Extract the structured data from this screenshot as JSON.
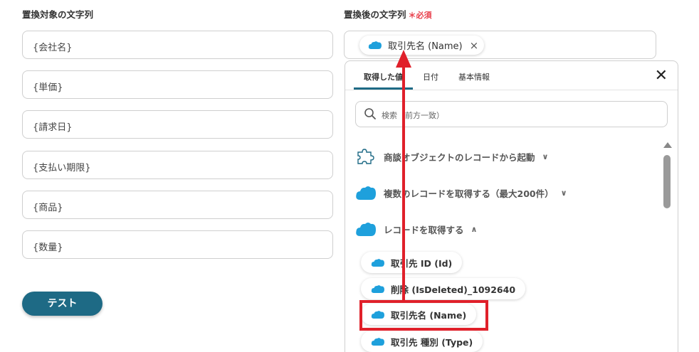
{
  "left": {
    "label": "置換対象の文字列",
    "fields": [
      "{会社名}",
      "{単価}",
      "{請求日}",
      "{支払い期限}",
      "{商品}",
      "{数量}"
    ],
    "test_button": "テスト"
  },
  "right": {
    "label": "置換後の文字列",
    "required_mark": "＊必須",
    "chip_label": "取引先名 (Name)",
    "chip_remove": "×"
  },
  "panel": {
    "tabs": [
      "取得した値",
      "日付",
      "基本情報"
    ],
    "close": "✕",
    "search_placeholder": "検索（前方一致）",
    "sections": [
      {
        "label": "商談オブジェクトのレコードから起動",
        "chevron": "∨",
        "icon": "puzzle-icon"
      },
      {
        "label": "複数のレコードを取得する（最大200件）",
        "chevron": "∨",
        "icon": "salesforce-cloud-icon"
      },
      {
        "label": "レコードを取得する",
        "chevron": "∧",
        "icon": "salesforce-cloud-icon"
      }
    ],
    "items": [
      "取引先 ID (Id)",
      "削除 (IsDeleted)_1092640",
      "取引先名 (Name)",
      "取引先 種別 (Type)"
    ]
  },
  "colors": {
    "accent": "#1e6a85",
    "salesforce_blue": "#1ea0dc",
    "annotation_red": "#e0202a",
    "required_red": "#e83e4a"
  }
}
